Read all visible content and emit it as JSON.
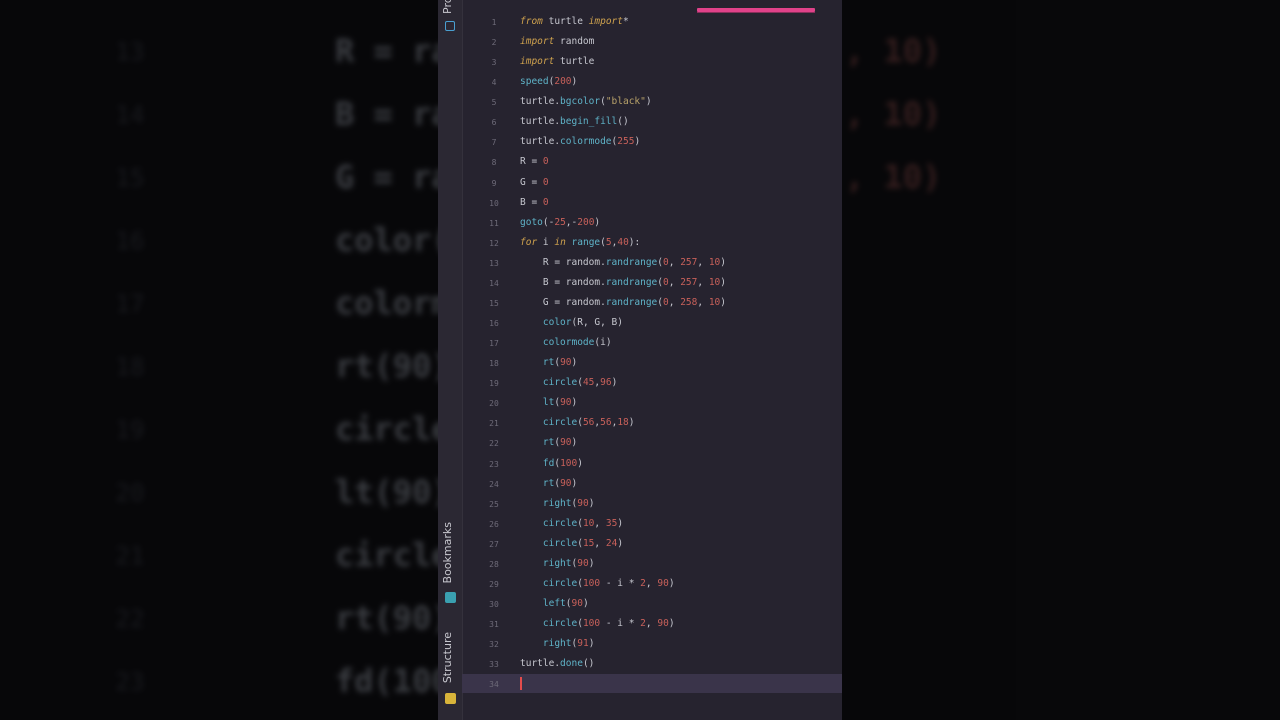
{
  "toolwindow": {
    "project_label": "Project",
    "bookmarks_label": "Bookmarks",
    "structure_label": "Structure"
  },
  "colors": {
    "keyword": "#cfa24e",
    "function": "#5fb3c8",
    "number": "#c7605a",
    "string": "#b8a26a",
    "tab_accent": "#e0428a"
  },
  "editor": {
    "lines": [
      {
        "n": "1",
        "code": "from turtle import*"
      },
      {
        "n": "2",
        "code": "import random"
      },
      {
        "n": "3",
        "code": "import turtle"
      },
      {
        "n": "4",
        "code": "speed(200)"
      },
      {
        "n": "5",
        "code": "turtle.bgcolor(\"black\")"
      },
      {
        "n": "6",
        "code": "turtle.begin_fill()"
      },
      {
        "n": "7",
        "code": "turtle.colormode(255)"
      },
      {
        "n": "8",
        "code": "R = 0"
      },
      {
        "n": "9",
        "code": "G = 0"
      },
      {
        "n": "10",
        "code": "B = 0"
      },
      {
        "n": "11",
        "code": "goto(-25,-200)"
      },
      {
        "n": "12",
        "code": "for i in range(5,40):"
      },
      {
        "n": "13",
        "code": "    R = random.randrange(0, 257, 10)"
      },
      {
        "n": "14",
        "code": "    B = random.randrange(0, 257, 10)"
      },
      {
        "n": "15",
        "code": "    G = random.randrange(0, 258, 10)"
      },
      {
        "n": "16",
        "code": "    color(R, G, B)"
      },
      {
        "n": "17",
        "code": "    colormode(i)"
      },
      {
        "n": "18",
        "code": "    rt(90)"
      },
      {
        "n": "19",
        "code": "    circle(45,96)"
      },
      {
        "n": "20",
        "code": "    lt(90)"
      },
      {
        "n": "21",
        "code": "    circle(56,56,18)"
      },
      {
        "n": "22",
        "code": "    rt(90)"
      },
      {
        "n": "23",
        "code": "    fd(100)"
      },
      {
        "n": "24",
        "code": "    rt(90)"
      },
      {
        "n": "25",
        "code": "    right(90)"
      },
      {
        "n": "26",
        "code": "    circle(10, 35)"
      },
      {
        "n": "27",
        "code": "    circle(15, 24)"
      },
      {
        "n": "28",
        "code": "    right(90)"
      },
      {
        "n": "29",
        "code": "    circle(100 - i * 2, 90)"
      },
      {
        "n": "30",
        "code": "    left(90)"
      },
      {
        "n": "31",
        "code": "    circle(100 - i * 2, 90)"
      },
      {
        "n": "32",
        "code": "    right(91)"
      },
      {
        "n": "33",
        "code": "turtle.done()"
      },
      {
        "n": "34",
        "code": ""
      }
    ]
  },
  "background": {
    "numbers": [
      "13",
      "14",
      "15",
      "16",
      "17",
      "18",
      "19",
      "20",
      "21",
      "22",
      "23"
    ],
    "code": [
      "R = ra",
      "B = ra",
      "G = ra",
      "color(",
      "colorm",
      "rt(90)",
      "circle",
      "lt(90)",
      "circle",
      "rt(90)",
      "fd(100"
    ],
    "right": [
      ", 10)",
      ", 10)",
      ", 10)"
    ]
  }
}
